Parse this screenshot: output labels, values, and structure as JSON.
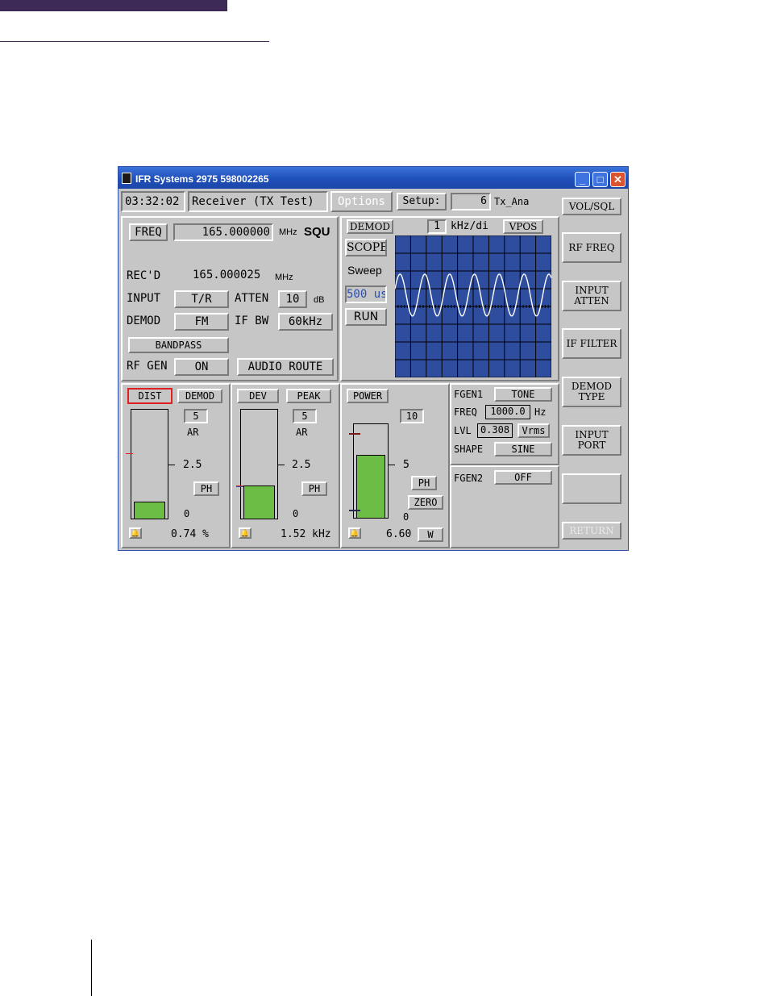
{
  "window": {
    "title": "IFR Systems 2975 598002265"
  },
  "header": {
    "clock": "03:32:02",
    "mode": "Receiver (TX Test)",
    "options_label": "Options",
    "setup_label": "Setup:",
    "setup_value": "6",
    "setup_name": "Tx_Ana"
  },
  "side_menu": {
    "items": [
      "VOL/SQL",
      "RF FREQ",
      "INPUT\nATTEN",
      "IF FILTER",
      "DEMOD\nTYPE",
      "INPUT\nPORT",
      "",
      "RETURN"
    ]
  },
  "receiver": {
    "freq_label": "FREQ",
    "freq_value": "165.000000",
    "freq_unit": "MHz",
    "squ_label": "SQU",
    "recd_label": "REC'D",
    "recd_value": "165.000025",
    "recd_unit": "MHz",
    "input_label": "INPUT",
    "input_value": "T/R",
    "atten_label": "ATTEN",
    "atten_value": "10",
    "atten_unit": "dB",
    "demod_label": "DEMOD",
    "demod_value": "FM",
    "ifbw_label": "IF BW",
    "ifbw_value": "60kHz",
    "bandpass_label": "BANDPASS",
    "rfgen_label": "RF GEN",
    "rfgen_value": "ON",
    "audio_route_label": "AUDIO ROUTE"
  },
  "scope": {
    "demod_label": "DEMOD",
    "scale_value": "1",
    "scale_unit": "kHz/di",
    "vpos_label": "VPOS",
    "scope_label": "SCOPE",
    "sweep_label": "Sweep",
    "sweep_value": "500 us",
    "run_label": "RUN",
    "grid_color": "#2f4d9e",
    "trace_color": "#ffffff"
  },
  "meters": {
    "dist": {
      "label": "DIST",
      "mode": "DEMOD",
      "range": "5",
      "ar": "AR",
      "mid": "2.5",
      "zero": "0",
      "ph": "PH",
      "reading": "0.74 %",
      "level_fraction": 0.15,
      "marker_fraction": 0.6
    },
    "dev": {
      "label": "DEV",
      "mode": "PEAK",
      "range": "5",
      "ar": "AR",
      "mid": "2.5",
      "zero": "0",
      "ph": "PH",
      "reading": "1.52 kHz",
      "level_fraction": 0.3,
      "marker_fraction": 0.31
    },
    "power": {
      "label": "POWER",
      "range": "10",
      "mid": "5",
      "zero": "0",
      "ph": "PH",
      "zero_btn": "ZERO",
      "reading": "6.60",
      "unit": "W",
      "level_fraction": 0.66,
      "marker_fraction": 0.9
    }
  },
  "fgen": {
    "fgen1_label": "FGEN1",
    "fgen1_value": "TONE",
    "freq_label": "FREQ",
    "freq_value": "1000.0",
    "freq_unit": "Hz",
    "lvl_label": "LVL",
    "lvl_value": "0.308",
    "lvl_unit": "Vrms",
    "shape_label": "SHAPE",
    "shape_value": "SINE",
    "fgen2_label": "FGEN2",
    "fgen2_value": "OFF"
  },
  "colors": {
    "meter_fill": "#6cbd45",
    "selected_border": "#e02020",
    "titlebar": "#2456c4"
  }
}
